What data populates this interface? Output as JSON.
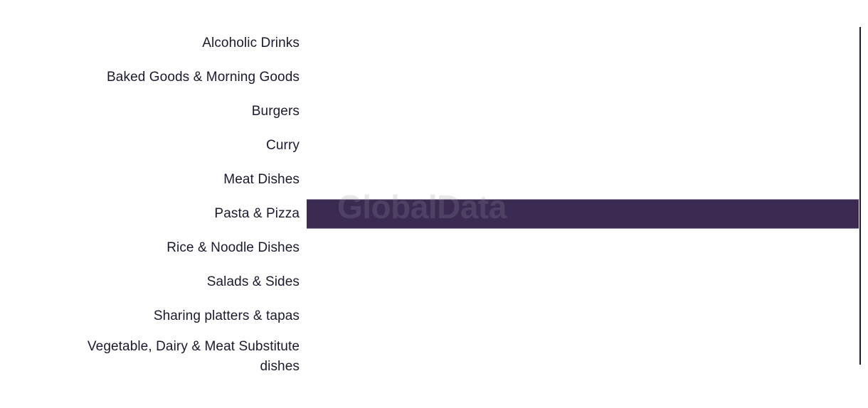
{
  "chart_data": {
    "type": "bar",
    "orientation": "horizontal",
    "title": "",
    "subtitle": "",
    "xlabel": "",
    "ylabel": "",
    "grid": false,
    "legend": false,
    "legend_position": "none",
    "axis_line": "right",
    "xlim": [
      0,
      100
    ],
    "categories": [
      "Alcoholic Drinks",
      "Baked Goods & Morning Goods",
      "Burgers",
      "Curry",
      "Meat Dishes",
      "Pasta & Pizza",
      "Rice & Noodle Dishes",
      "Salads & Sides",
      "Sharing platters & tapas",
      "Vegetable, Dairy & Meat Substitute\ndishes"
    ],
    "values": [
      0,
      0,
      0,
      0,
      0,
      100,
      0,
      0,
      0,
      0
    ],
    "tick_labels": [],
    "bar_color": "#3b2a52",
    "label_color": "#1a1a2e",
    "axis_color": "#1a1a2e",
    "background_color": "#ffffff"
  },
  "watermark": {
    "text": "GlobalData",
    "color": "#9696a5"
  }
}
